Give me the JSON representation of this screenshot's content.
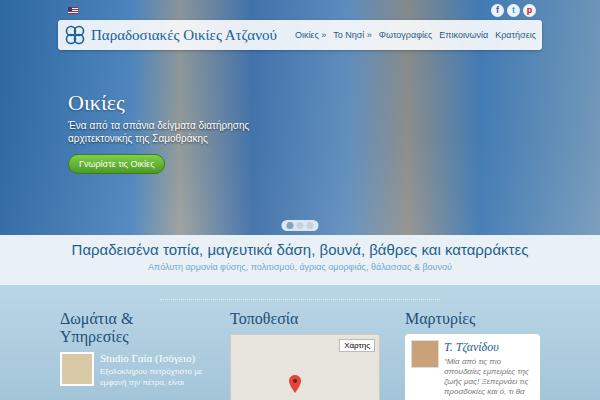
{
  "top_bar": {
    "social": [
      {
        "glyph": "f",
        "color": "#3b5998"
      },
      {
        "glyph": "t",
        "color": "#2aa9e0"
      },
      {
        "glyph": "p",
        "color": "#cb2027"
      }
    ]
  },
  "header": {
    "logo_title": "Παραδοσιακές Οικίες Ατζανού",
    "nav": [
      {
        "label": "Οικίες »"
      },
      {
        "label": "Το Νησί »"
      },
      {
        "label": "Φωτογραφίες"
      },
      {
        "label": "Επικοινωνία"
      },
      {
        "label": "Κρατήσεις"
      }
    ]
  },
  "hero": {
    "title": "Οικίες",
    "text": "Ένα από τα σπάνια δείγματα διατήρησης αρχιτεκτονικής της Σαμοθράκης",
    "button": "Γνωρίστε τις Οικίες"
  },
  "slider": {
    "dots": [
      {
        "selected": true
      },
      {
        "selected": false
      },
      {
        "selected": false
      }
    ]
  },
  "band": {
    "heading": "Παραδεισένα τοπία, μαγευτικά δάση, βουνά, βάθρες και καταρράκτες",
    "subheading": "Απόλυτη αρμονία φύσης, πολιτισμού, άγριας ομορφιάς, θάλασσας & βουνού"
  },
  "rooms": {
    "title": "Δωμάτια & Υπηρεσίες",
    "items": [
      {
        "name": "Studio Γαία (Ισόγειο)",
        "description": "Εξολοκλήρου πετρόχτιστο με εμφανή την πέτρα, είναι"
      }
    ]
  },
  "location": {
    "title": "Τοποθεσία",
    "map_button": "Χάρτης"
  },
  "testimonials": {
    "title": "Μαρτυρίες",
    "items": [
      {
        "author": "Τ. Τζανίδου",
        "quote": "“Μία από τις πιο σπουδαίες εμπειρίες της ζωής μας! Ξεπερνάει τις προσδοκίες και ό, τι θα"
      }
    ]
  }
}
